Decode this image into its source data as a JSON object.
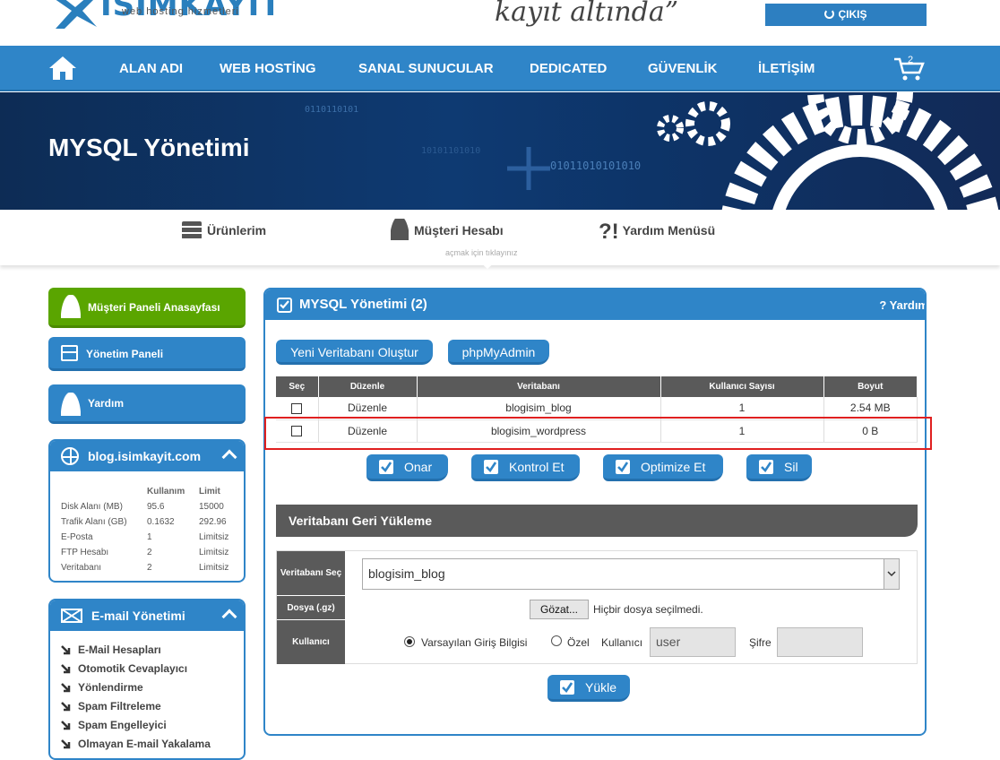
{
  "brand": {
    "name": "ISIMKAYIT",
    "tagline": "web hosting hizmetleri",
    "slogan": "kayıt altında”"
  },
  "header": {
    "logout_label": "ÇIKIŞ"
  },
  "nav": {
    "items": [
      "ALAN ADI",
      "WEB HOSTİNG",
      "SANAL SUNUCULAR",
      "DEDICATED",
      "GÜVENLİK",
      "İLETİŞİM"
    ],
    "cart_count": "2"
  },
  "banner": {
    "title": "MYSQL Yönetimi",
    "binary": [
      "0110110101",
      "01011010101010",
      "10101101010"
    ]
  },
  "subnav": {
    "products": "Ürünlerim",
    "account": "Müşteri Hesabı",
    "help": "Yardım Menüsü",
    "hint": "açmak için tıklayınız"
  },
  "sidebar": {
    "home": "Müşteri Paneli Anasayfası",
    "manage": "Yönetim Paneli",
    "help": "Yardım",
    "site_panel": {
      "title": "blog.isimkayit.com",
      "col_used": "Kullanım",
      "col_limit": "Limit",
      "rows": [
        {
          "label": "Disk Alanı (MB)",
          "used": "95.6",
          "limit": "15000"
        },
        {
          "label": "Trafik Alanı (GB)",
          "used": "0.1632",
          "limit": "292.96"
        },
        {
          "label": "E-Posta",
          "used": "1",
          "limit": "Limitsiz"
        },
        {
          "label": "FTP Hesabı",
          "used": "2",
          "limit": "Limitsiz"
        },
        {
          "label": "Veritabanı",
          "used": "2",
          "limit": "Limitsiz"
        }
      ]
    },
    "mail_panel": {
      "title": "E-mail Yönetimi",
      "items": [
        "E-Mail Hesapları",
        "Otomotik Cevaplayıcı",
        "Yönlendirme",
        "Spam Filtreleme",
        "Spam Engelleyici",
        "Olmayan E-mail Yakalama"
      ]
    }
  },
  "main": {
    "title": "MYSQL Yönetimi (2)",
    "help": "? Yardım",
    "new_db": "Yeni Veritabanı Oluştur",
    "phpmyadmin": "phpMyAdmin",
    "table": {
      "headers": [
        "Seç",
        "Düzenle",
        "Veritabanı",
        "Kullanıcı Sayısı",
        "Boyut"
      ],
      "rows": [
        {
          "edit": "Düzenle",
          "db": "blogisim_blog",
          "users": "1",
          "size": "2.54 MB"
        },
        {
          "edit": "Düzenle",
          "db": "blogisim_wordpress",
          "users": "1",
          "size": "0 B"
        }
      ]
    },
    "actions": {
      "repair": "Onar",
      "check": "Kontrol Et",
      "optimize": "Optimize Et",
      "delete": "Sil"
    },
    "restore": {
      "title": "Veritabanı Geri Yükleme",
      "label_db": "Veritabanı Seç",
      "label_file": "Dosya (.gz)",
      "label_user": "Kullanıcı",
      "selected_db": "blogisim_blog",
      "browse": "Gözat...",
      "no_file": "Hiçbir dosya seçilmedi.",
      "opt_default": "Varsayılan Giriş Bilgisi",
      "opt_custom": "Özel",
      "user_label": "Kullanıcı",
      "user_value": "user",
      "pass_label": "Şifre",
      "pass_value": "",
      "upload": "Yükle"
    }
  },
  "colors": {
    "primary": "#2f85c8",
    "dark": "#5a5a5a",
    "green": "#5aa500",
    "highlight": "#e02020"
  }
}
